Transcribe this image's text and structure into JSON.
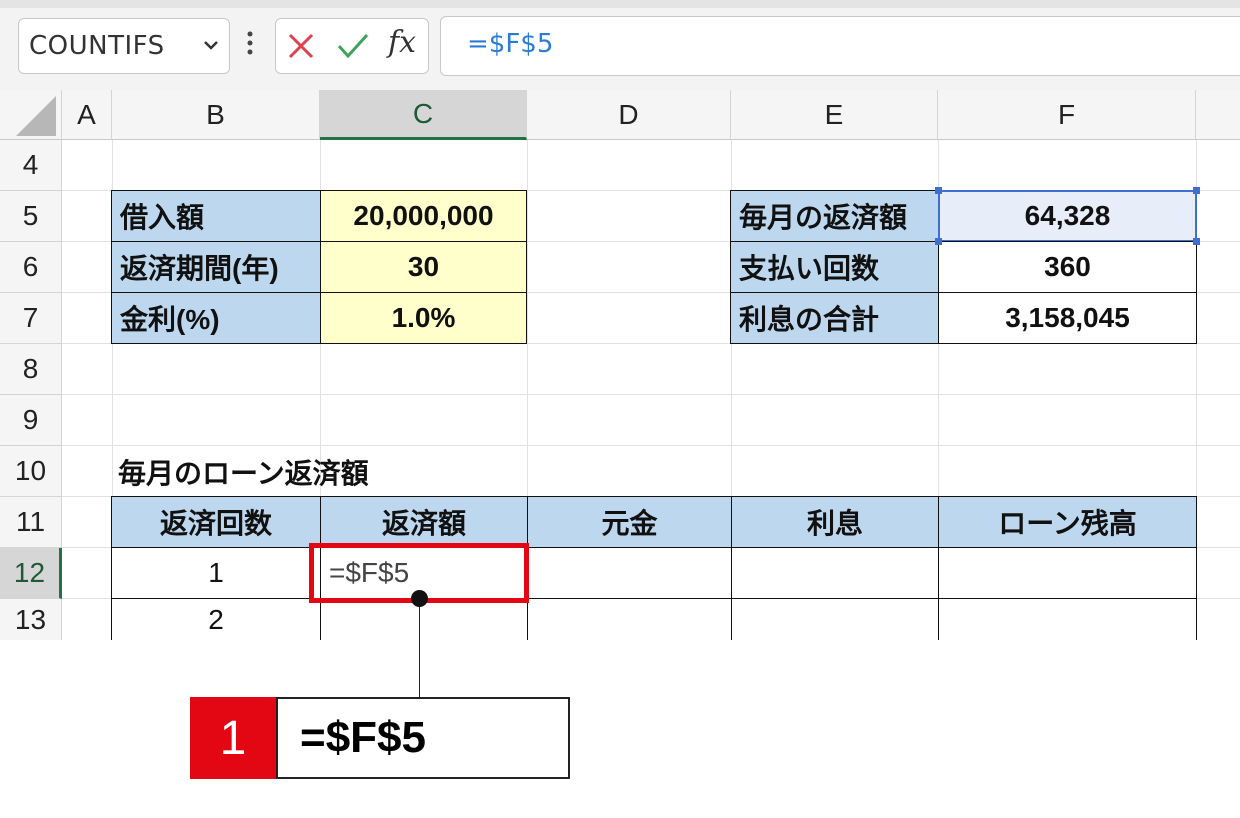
{
  "formula_bar": {
    "name_box": "COUNTIFS",
    "formula": "=$F$5"
  },
  "columns": [
    "A",
    "B",
    "C",
    "D",
    "E",
    "F"
  ],
  "rows": [
    "4",
    "5",
    "6",
    "7",
    "8",
    "9",
    "10",
    "11",
    "12",
    "13"
  ],
  "inputs": [
    {
      "label": "借入額",
      "value": "20,000,000"
    },
    {
      "label": "返済期間(年)",
      "value": "30"
    },
    {
      "label": "金利(%)",
      "value": "1.0%"
    }
  ],
  "outputs": [
    {
      "label": "毎月の返済額",
      "value": "64,328"
    },
    {
      "label": "支払い回数",
      "value": "360"
    },
    {
      "label": "利息の合計",
      "value": "3,158,045"
    }
  ],
  "table_title": "毎月のローン返済額",
  "table": {
    "headers": [
      "返済回数",
      "返済額",
      "元金",
      "利息",
      "ローン残高"
    ],
    "rows": [
      [
        "1",
        "=$F$5",
        "",
        "",
        ""
      ],
      [
        "2",
        "",
        "",
        "",
        ""
      ]
    ]
  },
  "callout": {
    "step": "1",
    "text": "=$F$5"
  },
  "colors": {
    "label_fill": "#bdd7ee",
    "input_fill": "#ffffcc",
    "highlight": "#e30613",
    "selection": "#3f6fd0",
    "excel_green": "#217346"
  }
}
